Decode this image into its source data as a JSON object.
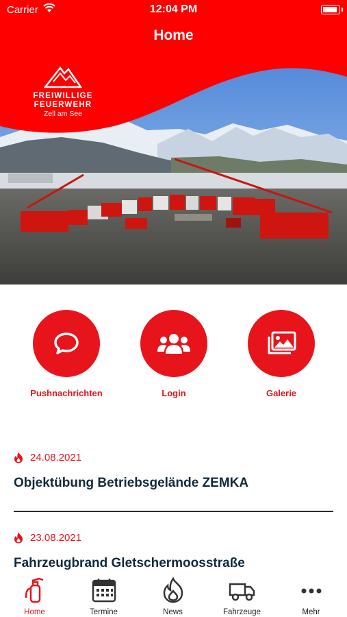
{
  "status_bar": {
    "carrier": "Carrier",
    "time": "12:04 PM"
  },
  "nav": {
    "title": "Home"
  },
  "logo": {
    "line1": "FREIWILLIGE",
    "line2": "FEUERWEHR",
    "line3": "Zell am See"
  },
  "actions": [
    {
      "label": "Pushnachrichten",
      "icon": "chat-bubble-icon"
    },
    {
      "label": "Login",
      "icon": "users-icon"
    },
    {
      "label": "Galerie",
      "icon": "images-icon"
    }
  ],
  "news": [
    {
      "date": "24.08.2021",
      "title": "Objektübung Betriebsgelände ZEMKA"
    },
    {
      "date": "23.08.2021",
      "title": "Fahrzeugbrand Gletschermoosstraße"
    }
  ],
  "tabbar": [
    {
      "label": "Home",
      "icon": "fire-extinguisher-icon",
      "active": true
    },
    {
      "label": "Termine",
      "icon": "calendar-icon",
      "active": false
    },
    {
      "label": "News",
      "icon": "flame-icon",
      "active": false
    },
    {
      "label": "Fahrzeuge",
      "icon": "truck-icon",
      "active": false
    },
    {
      "label": "Mehr",
      "icon": "more-dots-icon",
      "active": false
    }
  ],
  "colors": {
    "brand_red": "#e8141b",
    "title_navy": "#0e2a3c"
  }
}
